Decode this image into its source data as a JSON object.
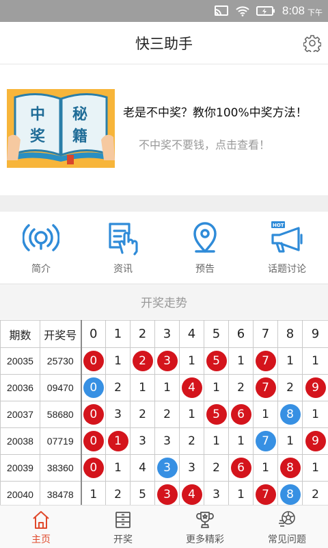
{
  "status_bar": {
    "time": "8:08",
    "ampm": "下午",
    "icons": [
      "cast-icon",
      "wifi-icon",
      "battery-icon"
    ]
  },
  "header": {
    "title": "快三助手",
    "settings_icon": "gear-icon"
  },
  "banner": {
    "book_text": [
      "中",
      "秘",
      "奖",
      "籍"
    ],
    "headline": "老是不中奖？教你100%中奖方法！",
    "subline": "不中奖不要钱，点击查看！"
  },
  "nav": [
    {
      "label": "简介",
      "icon": "broadcast-icon"
    },
    {
      "label": "资讯",
      "icon": "document-hand-icon"
    },
    {
      "label": "预告",
      "icon": "location-pin-icon"
    },
    {
      "label": "话题讨论",
      "icon": "megaphone-hot-icon",
      "badge": "HOT"
    }
  ],
  "trend": {
    "title": "开奖走势",
    "headers": {
      "issue": "期数",
      "number": "开奖号",
      "digits": [
        "0",
        "1",
        "2",
        "3",
        "4",
        "5",
        "6",
        "7",
        "8",
        "9"
      ]
    },
    "rows": [
      {
        "issue": "20035",
        "number": "25730",
        "cells": [
          {
            "v": "0",
            "c": "red"
          },
          {
            "v": "1",
            "c": ""
          },
          {
            "v": "2",
            "c": "red"
          },
          {
            "v": "3",
            "c": "red"
          },
          {
            "v": "1",
            "c": ""
          },
          {
            "v": "5",
            "c": "red"
          },
          {
            "v": "1",
            "c": ""
          },
          {
            "v": "7",
            "c": "red"
          },
          {
            "v": "1",
            "c": ""
          },
          {
            "v": "1",
            "c": ""
          }
        ]
      },
      {
        "issue": "20036",
        "number": "09470",
        "cells": [
          {
            "v": "0",
            "c": "blue"
          },
          {
            "v": "2",
            "c": ""
          },
          {
            "v": "1",
            "c": ""
          },
          {
            "v": "1",
            "c": ""
          },
          {
            "v": "4",
            "c": "red"
          },
          {
            "v": "1",
            "c": ""
          },
          {
            "v": "2",
            "c": ""
          },
          {
            "v": "7",
            "c": "red"
          },
          {
            "v": "2",
            "c": ""
          },
          {
            "v": "9",
            "c": "red"
          }
        ]
      },
      {
        "issue": "20037",
        "number": "58680",
        "cells": [
          {
            "v": "0",
            "c": "red"
          },
          {
            "v": "3",
            "c": ""
          },
          {
            "v": "2",
            "c": ""
          },
          {
            "v": "2",
            "c": ""
          },
          {
            "v": "1",
            "c": ""
          },
          {
            "v": "5",
            "c": "red"
          },
          {
            "v": "6",
            "c": "red"
          },
          {
            "v": "1",
            "c": ""
          },
          {
            "v": "8",
            "c": "blue"
          },
          {
            "v": "1",
            "c": ""
          }
        ]
      },
      {
        "issue": "20038",
        "number": "07719",
        "cells": [
          {
            "v": "0",
            "c": "red"
          },
          {
            "v": "1",
            "c": "red"
          },
          {
            "v": "3",
            "c": ""
          },
          {
            "v": "3",
            "c": ""
          },
          {
            "v": "2",
            "c": ""
          },
          {
            "v": "1",
            "c": ""
          },
          {
            "v": "1",
            "c": ""
          },
          {
            "v": "7",
            "c": "blue"
          },
          {
            "v": "1",
            "c": ""
          },
          {
            "v": "9",
            "c": "red"
          }
        ]
      },
      {
        "issue": "20039",
        "number": "38360",
        "cells": [
          {
            "v": "0",
            "c": "red"
          },
          {
            "v": "1",
            "c": ""
          },
          {
            "v": "4",
            "c": ""
          },
          {
            "v": "3",
            "c": "blue"
          },
          {
            "v": "3",
            "c": ""
          },
          {
            "v": "2",
            "c": ""
          },
          {
            "v": "6",
            "c": "red"
          },
          {
            "v": "1",
            "c": ""
          },
          {
            "v": "8",
            "c": "red"
          },
          {
            "v": "1",
            "c": ""
          }
        ]
      },
      {
        "issue": "20040",
        "number": "38478",
        "cells": [
          {
            "v": "1",
            "c": ""
          },
          {
            "v": "2",
            "c": ""
          },
          {
            "v": "5",
            "c": ""
          },
          {
            "v": "3",
            "c": "red"
          },
          {
            "v": "4",
            "c": "red"
          },
          {
            "v": "3",
            "c": ""
          },
          {
            "v": "1",
            "c": ""
          },
          {
            "v": "7",
            "c": "red"
          },
          {
            "v": "8",
            "c": "blue"
          },
          {
            "v": "2",
            "c": ""
          }
        ]
      }
    ]
  },
  "tabs": [
    {
      "label": "主页",
      "icon": "home-icon",
      "active": true
    },
    {
      "label": "开奖",
      "icon": "cabinet-icon",
      "active": false
    },
    {
      "label": "更多精彩",
      "icon": "trophy-icon",
      "active": false
    },
    {
      "label": "常见问题",
      "icon": "soccer-ball-icon",
      "active": false
    }
  ],
  "colors": {
    "accent": "#e0492b",
    "ball_red": "#d4141c",
    "ball_blue": "#3790e3",
    "icon_blue": "#2f8bd8",
    "banner_bg": "#f7b53a"
  }
}
